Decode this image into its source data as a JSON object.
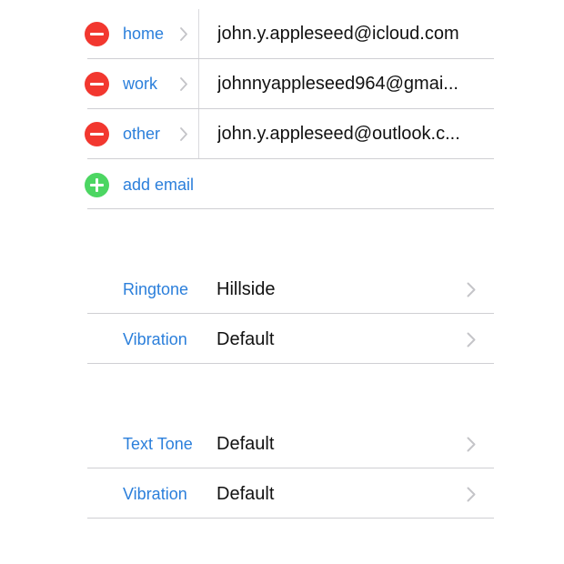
{
  "emails": [
    {
      "label": "home",
      "value": "john.y.appleseed@icloud.com"
    },
    {
      "label": "work",
      "value": "johnnyappleseed964@gmai..."
    },
    {
      "label": "other",
      "value": "john.y.appleseed@outlook.c..."
    }
  ],
  "add_email": {
    "label": "add email"
  },
  "ringtone_section": {
    "ringtone": {
      "label": "Ringtone",
      "value": "Hillside"
    },
    "vibration": {
      "label": "Vibration",
      "value": "Default"
    }
  },
  "text_tone_section": {
    "text_tone": {
      "label": "Text Tone",
      "value": "Default"
    },
    "vibration": {
      "label": "Vibration",
      "value": "Default"
    }
  },
  "colors": {
    "accent": "#2b7fdb",
    "remove": "#f2372f",
    "add": "#4cd662",
    "separator": "#cfcfd3"
  }
}
